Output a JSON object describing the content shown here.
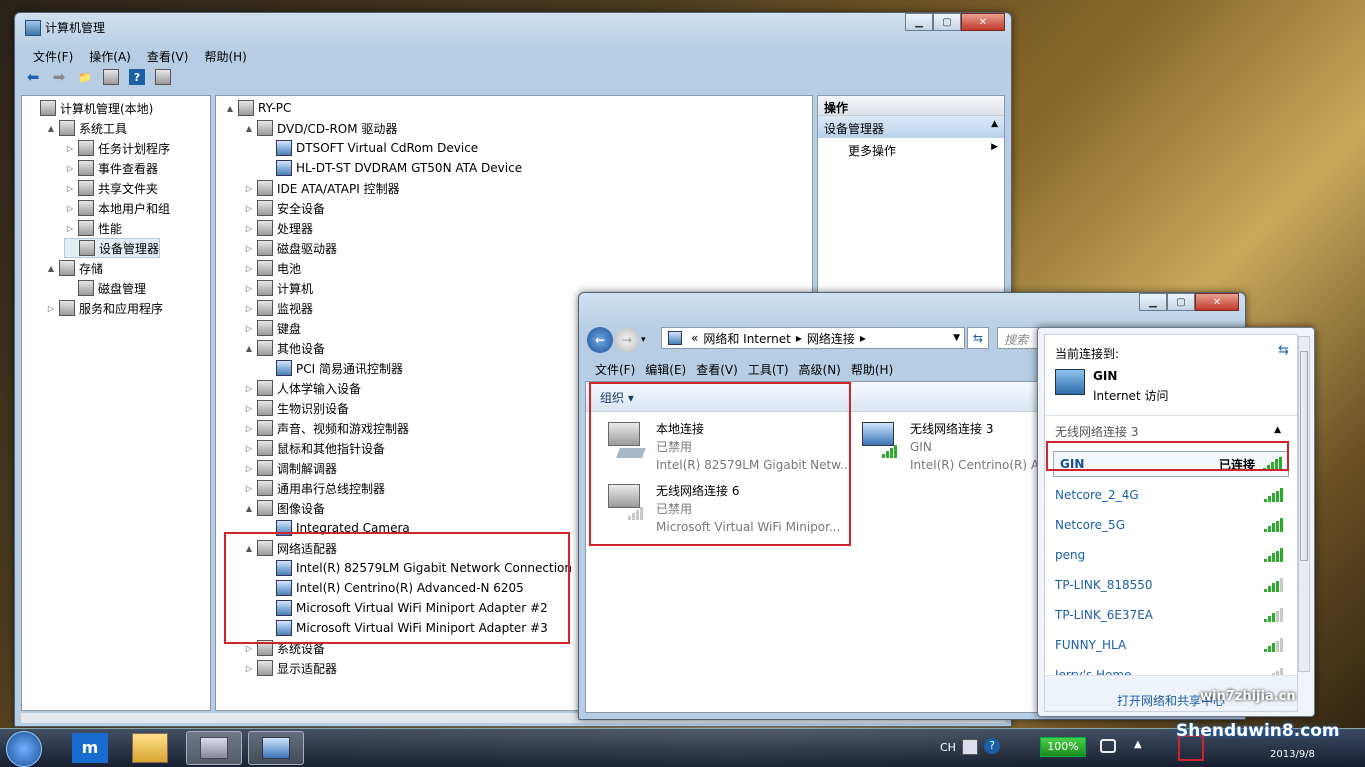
{
  "cm": {
    "title": "计算机管理",
    "menu": [
      "文件(F)",
      "操作(A)",
      "查看(V)",
      "帮助(H)"
    ],
    "left": [
      {
        "label": "计算机管理(本地)",
        "icon": "computer-icon",
        "level": 0,
        "tw": ""
      },
      {
        "label": "系统工具",
        "icon": "tools-icon",
        "level": 1,
        "tw": "▲"
      },
      {
        "label": "任务计划程序",
        "icon": "clock-icon",
        "level": 2,
        "tw": "▷"
      },
      {
        "label": "事件查看器",
        "icon": "event-viewer-icon",
        "level": 2,
        "tw": "▷"
      },
      {
        "label": "共享文件夹",
        "icon": "shared-folder-icon",
        "level": 2,
        "tw": "▷"
      },
      {
        "label": "本地用户和组",
        "icon": "users-icon",
        "level": 2,
        "tw": "▷"
      },
      {
        "label": "性能",
        "icon": "performance-icon",
        "level": 2,
        "tw": "▷"
      },
      {
        "label": "设备管理器",
        "icon": "device-manager-icon",
        "level": 2,
        "tw": ""
      },
      {
        "label": "存储",
        "icon": "storage-icon",
        "level": 1,
        "tw": "▲"
      },
      {
        "label": "磁盘管理",
        "icon": "disk-icon",
        "level": 2,
        "tw": ""
      },
      {
        "label": "服务和应用程序",
        "icon": "services-icon",
        "level": 1,
        "tw": "▷"
      }
    ],
    "tree": [
      {
        "label": "RY-PC",
        "level": 0,
        "tw": "▲"
      },
      {
        "label": "DVD/CD-ROM 驱动器",
        "level": 1,
        "tw": "▲"
      },
      {
        "label": "DTSOFT Virtual CdRom Device",
        "level": 2,
        "tw": ""
      },
      {
        "label": "HL-DT-ST DVDRAM GT50N ATA Device",
        "level": 2,
        "tw": ""
      },
      {
        "label": "IDE ATA/ATAPI 控制器",
        "level": 1,
        "tw": "▷"
      },
      {
        "label": "安全设备",
        "level": 1,
        "tw": "▷"
      },
      {
        "label": "处理器",
        "level": 1,
        "tw": "▷"
      },
      {
        "label": "磁盘驱动器",
        "level": 1,
        "tw": "▷"
      },
      {
        "label": "电池",
        "level": 1,
        "tw": "▷"
      },
      {
        "label": "计算机",
        "level": 1,
        "tw": "▷"
      },
      {
        "label": "监视器",
        "level": 1,
        "tw": "▷"
      },
      {
        "label": "键盘",
        "level": 1,
        "tw": "▷"
      },
      {
        "label": "其他设备",
        "level": 1,
        "tw": "▲"
      },
      {
        "label": "PCI 简易通讯控制器",
        "level": 2,
        "tw": ""
      },
      {
        "label": "人体学输入设备",
        "level": 1,
        "tw": "▷"
      },
      {
        "label": "生物识别设备",
        "level": 1,
        "tw": "▷"
      },
      {
        "label": "声音、视频和游戏控制器",
        "level": 1,
        "tw": "▷"
      },
      {
        "label": "鼠标和其他指针设备",
        "level": 1,
        "tw": "▷"
      },
      {
        "label": "调制解调器",
        "level": 1,
        "tw": "▷"
      },
      {
        "label": "通用串行总线控制器",
        "level": 1,
        "tw": "▷"
      },
      {
        "label": "图像设备",
        "level": 1,
        "tw": "▲"
      },
      {
        "label": "Integrated Camera",
        "level": 2,
        "tw": ""
      },
      {
        "label": "网络适配器",
        "level": 1,
        "tw": "▲"
      },
      {
        "label": "Intel(R) 82579LM Gigabit Network Connection",
        "level": 2,
        "tw": ""
      },
      {
        "label": "Intel(R) Centrino(R) Advanced-N 6205",
        "level": 2,
        "tw": ""
      },
      {
        "label": "Microsoft Virtual WiFi Miniport Adapter #2",
        "level": 2,
        "tw": ""
      },
      {
        "label": "Microsoft Virtual WiFi Miniport Adapter #3",
        "level": 2,
        "tw": ""
      },
      {
        "label": "系统设备",
        "level": 1,
        "tw": "▷"
      },
      {
        "label": "显示适配器",
        "level": 1,
        "tw": "▷"
      }
    ],
    "actions": {
      "header": "操作",
      "section": "设备管理器",
      "more": "更多操作"
    }
  },
  "nc": {
    "breadcrumb": [
      "«",
      "网络和 Internet",
      "▸",
      "网络连接",
      "▸"
    ],
    "search": "搜索",
    "menu": [
      "文件(F)",
      "编辑(E)",
      "查看(V)",
      "工具(T)",
      "高级(N)",
      "帮助(H)"
    ],
    "organize": "组织 ▾",
    "items": [
      {
        "name": "本地连接",
        "status": "已禁用",
        "device": "Intel(R) 82579LM Gigabit Netw..."
      },
      {
        "name": "无线网络连接 6",
        "status": "已禁用",
        "device": "Microsoft Virtual WiFi Minipor..."
      },
      {
        "name": "无线网络连接 3",
        "status": "GIN",
        "device": "Intel(R) Centrino(R) Ad"
      }
    ]
  },
  "wifi": {
    "current_label": "当前连接到:",
    "net_name": "GIN",
    "net_access": "Internet 访问",
    "section": "无线网络连接 3",
    "connected_name": "GIN",
    "connected_status": "已连接",
    "networks": [
      {
        "name": "Netcore_2_4G",
        "bars": 5
      },
      {
        "name": "Netcore_5G",
        "bars": 5
      },
      {
        "name": "peng",
        "bars": 5
      },
      {
        "name": "TP-LINK_818550",
        "bars": 4
      },
      {
        "name": "TP-LINK_6E37EA",
        "bars": 3
      },
      {
        "name": "FUNNY_HLA",
        "bars": 3
      },
      {
        "name": "Jerry's Home",
        "bars": 2
      }
    ],
    "footer": "打开网络和共享中心"
  },
  "taskbar": {
    "lang": "CH",
    "battery": "100%",
    "date": "2013/9/8",
    "watermark": "Shenduwin8.com",
    "watermark2": "win7zhijia.cn"
  },
  "colors": {
    "highlight": "#d0242c",
    "accent": "#1a5fa8",
    "signal": "#2eaa2e"
  }
}
